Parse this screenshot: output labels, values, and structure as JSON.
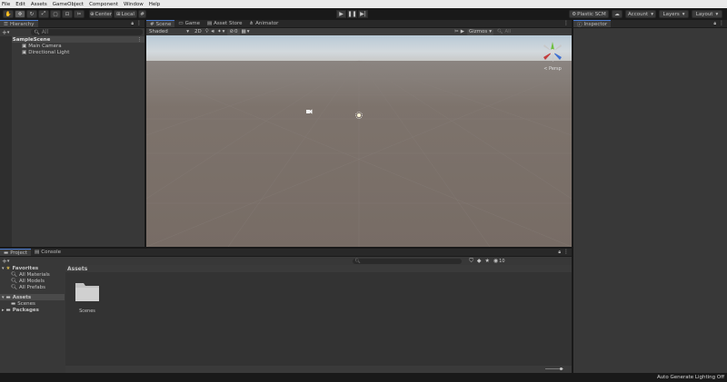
{
  "menu": [
    "File",
    "Edit",
    "Assets",
    "GameObject",
    "Component",
    "Window",
    "Help"
  ],
  "toolbar": {
    "center_label": "Center",
    "local_label": "Local",
    "plastic_label": "Plastic SCM",
    "account_label": "Account",
    "layers_label": "Layers",
    "layout_label": "Layout"
  },
  "hierarchy": {
    "tab": "Hierarchy",
    "search_placeholder": "All",
    "scene": "SampleScene",
    "items": [
      "Main Camera",
      "Directional Light"
    ]
  },
  "scene_tabs": [
    "Scene",
    "Game",
    "Asset Store",
    "Animator"
  ],
  "scene_toolbar": {
    "shading": "Shaded",
    "mode_2d": "2D",
    "gizmos": "Gizmos",
    "count": "0",
    "search": "All"
  },
  "gizmo": {
    "persp": "< Persp"
  },
  "inspector": {
    "tab": "Inspector"
  },
  "project": {
    "tabs": [
      "Project",
      "Console"
    ],
    "favorites": "Favorites",
    "fav_items": [
      "All Materials",
      "All Models",
      "All Prefabs"
    ],
    "assets": "Assets",
    "assets_children": [
      "Scenes"
    ],
    "packages": "Packages",
    "breadcrumb": "Assets",
    "folder_label": "Scenes",
    "badge": "10"
  },
  "status": {
    "lighting": "Auto Generate Lighting Off"
  },
  "colors": {
    "accent": "#4a7bd1",
    "sky": "#aab8c4",
    "ground": "#7b716a"
  }
}
